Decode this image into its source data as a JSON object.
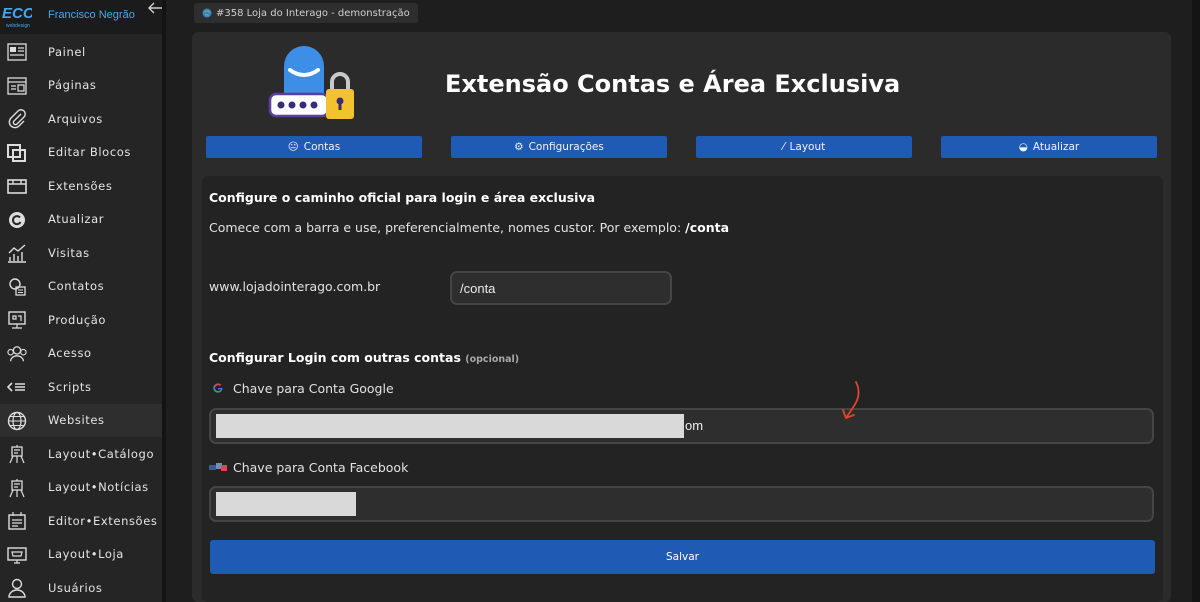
{
  "sidebar": {
    "user_name": "Francisco Negrão",
    "items": [
      {
        "label": "Painel",
        "icon": "dashboard-icon"
      },
      {
        "label": "Páginas",
        "icon": "pages-icon"
      },
      {
        "label": "Arquivos",
        "icon": "paperclip-icon"
      },
      {
        "label": "Editar Blocos",
        "icon": "blocks-icon"
      },
      {
        "label": "Extensões",
        "icon": "extensions-icon"
      },
      {
        "label": "Atualizar",
        "icon": "refresh-icon"
      },
      {
        "label": "Visitas",
        "icon": "stats-icon"
      },
      {
        "label": "Contatos",
        "icon": "contacts-icon"
      },
      {
        "label": "Produção",
        "icon": "production-icon"
      },
      {
        "label": "Acesso",
        "icon": "users-group-icon"
      },
      {
        "label": "Scripts",
        "icon": "scripts-icon"
      },
      {
        "label": "Websites",
        "icon": "globe-icon"
      },
      {
        "label": "Layout•Catálogo",
        "icon": "easel-icon"
      },
      {
        "label": "Layout•Notícias",
        "icon": "easel-icon"
      },
      {
        "label": "Editor•Extensões",
        "icon": "editor-icon"
      },
      {
        "label": "Layout•Loja",
        "icon": "store-icon"
      },
      {
        "label": "Usuários",
        "icon": "user-icon"
      }
    ]
  },
  "header": {
    "project_chip": "#358 Loja do Interago - demonstração"
  },
  "main": {
    "title": "Extensão Contas e Área Exclusiva",
    "tabs": [
      {
        "label": "Contas",
        "icon": "smiley-icon"
      },
      {
        "label": "Configurações",
        "icon": "gear-icon"
      },
      {
        "label": "Layout",
        "icon": "brush-icon"
      },
      {
        "label": "Atualizar",
        "icon": "globe-icon"
      }
    ],
    "card": {
      "heading": "Configure o caminho oficial para login e área exclusiva",
      "desc_prefix": "Comece com a barra e use, preferencialmente, nomes custor. Por exemplo: ",
      "desc_example": "/conta",
      "domain": "www.lojadointerago.com.br",
      "path_value": "/conta",
      "social_heading": "Configurar Login com outras contas",
      "social_optional": "(opcional)",
      "google_label": "Chave para Conta Google",
      "google_value_tail": "om",
      "facebook_label": "Chave para Conta Facebook",
      "save_label": "Salvar"
    }
  },
  "colors": {
    "accent_blue": "#1f5ab5",
    "user_name": "#4aa8e8",
    "annotation_arrow": "#e0452a"
  }
}
